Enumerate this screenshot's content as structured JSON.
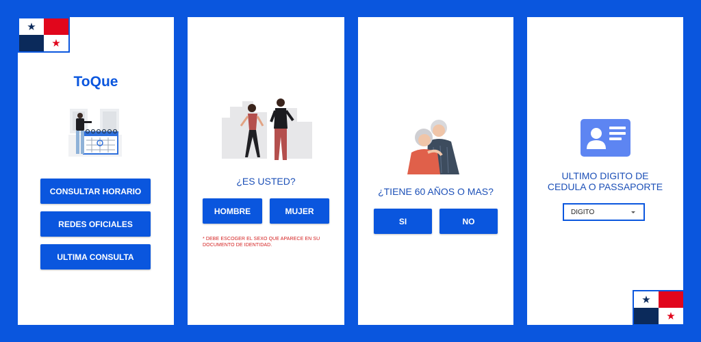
{
  "screen1": {
    "app_title": "ToQue",
    "buttons": [
      "CONSULTAR HORARIO",
      "REDES OFICIALES",
      "ULTIMA CONSULTA"
    ]
  },
  "screen2": {
    "question": "¿ES USTED?",
    "options": [
      "HOMBRE",
      "MUJER"
    ],
    "note_line1": "* DEBE ESCOGER EL SEXO QUE APARECE EN SU",
    "note_line2": "DOCUMENTO DE IDENTIDAD."
  },
  "screen3": {
    "question": "¿TIENE 60 AÑOS O MAS?",
    "options": [
      "SI",
      "NO"
    ]
  },
  "screen4": {
    "prompt_line1": "ULTIMO DIGITO DE",
    "prompt_line2": "CEDULA O PASSAPORTE",
    "select_value": "DIGITO"
  },
  "flag": {
    "star": "★"
  },
  "colors": {
    "background": "#0a56de",
    "accent": "#0a56de",
    "warning": "#d31d1d",
    "flag_red": "#e1061c",
    "flag_blue": "#0b2a5b"
  },
  "icons": [
    "panama-flag-icon",
    "calendar-person-illustration",
    "couple-walking-illustration",
    "elderly-couple-illustration",
    "id-card-icon",
    "dropdown-caret-icon"
  ]
}
